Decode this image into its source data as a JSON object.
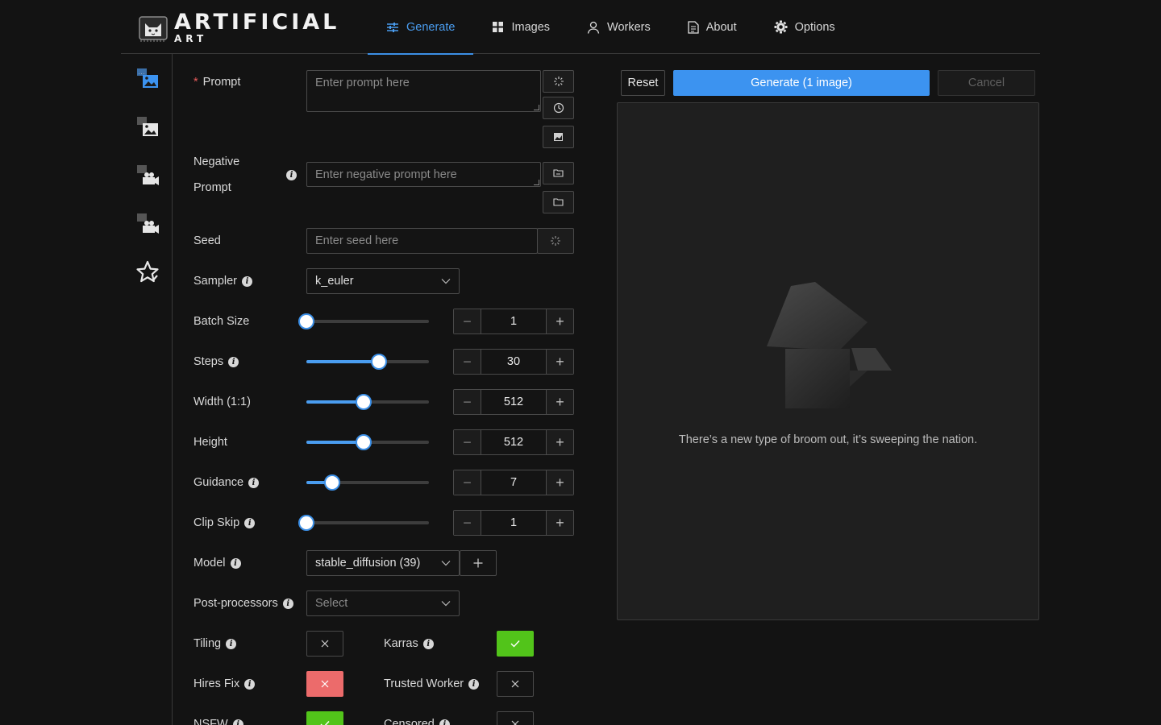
{
  "app": {
    "logo_main": "ARTIFICIAL",
    "logo_sub": "ART"
  },
  "nav": [
    {
      "label": "Generate",
      "icon": "sliders-icon",
      "active": true
    },
    {
      "label": "Images",
      "icon": "grid-icon"
    },
    {
      "label": "Workers",
      "icon": "user-icon"
    },
    {
      "label": "About",
      "icon": "document-icon"
    },
    {
      "label": "Options",
      "icon": "gear-icon"
    }
  ],
  "sidebar": [
    "text-to-image-icon",
    "image-to-image-icon",
    "workers-icon",
    "interrogate-icon",
    "favorites-star-icon"
  ],
  "form": {
    "prompt": {
      "required_mark": "*",
      "label": "Prompt",
      "placeholder": "Enter prompt here"
    },
    "negative": {
      "label_line1": "Negative",
      "label_line2": "Prompt",
      "placeholder": "Enter negative prompt here"
    },
    "seed": {
      "label": "Seed",
      "placeholder": "Enter seed here"
    },
    "sampler": {
      "label": "Sampler",
      "value": "k_euler"
    },
    "batch_size": {
      "label": "Batch Size",
      "value": "1",
      "fraction": 0.0
    },
    "steps": {
      "label": "Steps",
      "value": "30",
      "fraction": 0.59
    },
    "width": {
      "label": "Width (1:1)",
      "value": "512",
      "fraction": 0.47
    },
    "height": {
      "label": "Height",
      "value": "512",
      "fraction": 0.47
    },
    "guidance": {
      "label": "Guidance",
      "value": "7",
      "fraction": 0.21
    },
    "clip_skip": {
      "label": "Clip Skip",
      "value": "1",
      "fraction": 0.0
    },
    "model": {
      "label": "Model",
      "value": "stable_diffusion (39)"
    },
    "post_processors": {
      "label": "Post-processors",
      "placeholder": "Select"
    },
    "tiling": {
      "label": "Tiling",
      "state": "off"
    },
    "karras": {
      "label": "Karras",
      "state": "on"
    },
    "hires_fix": {
      "label": "Hires Fix",
      "state": "off-red"
    },
    "trusted_worker": {
      "label": "Trusted Worker",
      "state": "off"
    },
    "nsfw": {
      "label": "NSFW",
      "state": "on"
    },
    "censored": {
      "label": "Censored",
      "state": "off"
    }
  },
  "actions": {
    "reset": "Reset",
    "generate": "Generate (1 image)",
    "cancel": "Cancel"
  },
  "preview": {
    "empty_text": "There’s a new type of broom out, it’s sweeping the nation."
  },
  "colors": {
    "accent": "#3c93f0",
    "success": "#52c41a",
    "danger": "#ec6b6b"
  }
}
